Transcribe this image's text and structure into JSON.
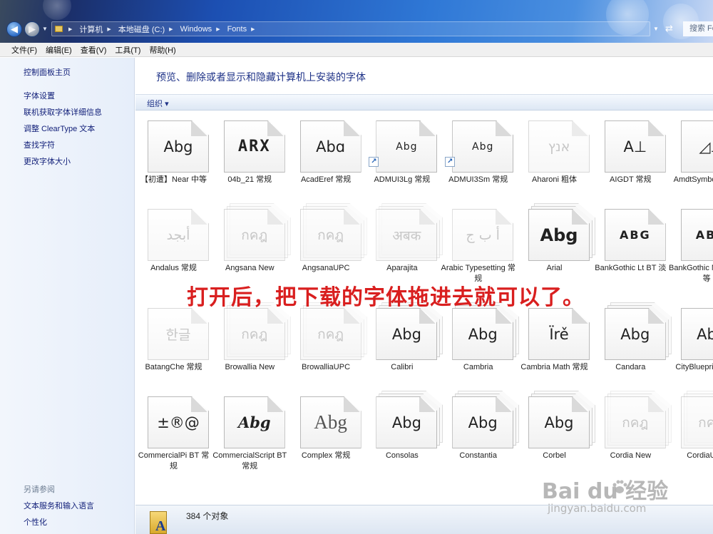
{
  "window": {
    "breadcrumbs": [
      "计算机",
      "本地磁盘 (C:)",
      "Windows",
      "Fonts"
    ],
    "search_placeholder": "搜索 Fo",
    "accent": "#1c4fb2"
  },
  "menu": [
    "文件(F)",
    "编辑(E)",
    "查看(V)",
    "工具(T)",
    "帮助(H)"
  ],
  "sidebar": {
    "home": "控制面板主页",
    "links": [
      "字体设置",
      "联机获取字体详细信息",
      "调整 ClearType 文本",
      "查找字符",
      "更改字体大小"
    ],
    "see_also_heading": "另请参阅",
    "see_also": [
      "文本服务和输入语言",
      "个性化"
    ]
  },
  "main": {
    "heading": "预览、删除或者显示和隐藏计算机上安装的字体",
    "organize": "组织"
  },
  "fonts": [
    {
      "name": "【初遭】Near 中等",
      "sample": "Abg",
      "style": "",
      "stack": false,
      "hidden": false,
      "shortcut": false
    },
    {
      "name": "04b_21 常规",
      "sample": "ARX",
      "style": "mono",
      "stack": false,
      "hidden": false,
      "shortcut": false
    },
    {
      "name": "AcadEref 常规",
      "sample": "Abɑ",
      "style": "",
      "stack": false,
      "hidden": false,
      "shortcut": false
    },
    {
      "name": "ADMUI3Lg 常规",
      "sample": "Abg",
      "style": "small",
      "stack": false,
      "hidden": false,
      "shortcut": true
    },
    {
      "name": "ADMUI3Sm 常规",
      "sample": "Abg",
      "style": "small",
      "stack": false,
      "hidden": false,
      "shortcut": true
    },
    {
      "name": "Aharoni 粗体",
      "sample": "אנץ",
      "style": "ghost",
      "stack": false,
      "hidden": true,
      "shortcut": false
    },
    {
      "name": "AIGDT 常规",
      "sample": "A⊥",
      "style": "",
      "stack": false,
      "hidden": false,
      "shortcut": false
    },
    {
      "name": "AmdtSymbols 常规",
      "sample": "◿⊥",
      "style": "",
      "stack": false,
      "hidden": false,
      "shortcut": false
    },
    {
      "name": "Andalus 常规",
      "sample": "أبجد",
      "style": "ghost",
      "stack": false,
      "hidden": true,
      "shortcut": false
    },
    {
      "name": "Angsana New",
      "sample": "กคฎ",
      "style": "ghost",
      "stack": true,
      "hidden": true,
      "shortcut": false
    },
    {
      "name": "AngsanaUPC",
      "sample": "กคฎ",
      "style": "ghost",
      "stack": true,
      "hidden": true,
      "shortcut": false
    },
    {
      "name": "Aparajita",
      "sample": "अबक",
      "style": "ghost",
      "stack": true,
      "hidden": true,
      "shortcut": false
    },
    {
      "name": "Arabic Typesetting 常规",
      "sample": "أ ب ج",
      "style": "ghost",
      "stack": false,
      "hidden": true,
      "shortcut": false
    },
    {
      "name": "Arial",
      "sample": "Abg",
      "style": "bold",
      "stack": true,
      "hidden": false,
      "shortcut": false
    },
    {
      "name": "BankGothic Lt BT 淡",
      "sample": "ABG",
      "style": "caps",
      "stack": false,
      "hidden": false,
      "shortcut": false
    },
    {
      "name": "BankGothic Md BT 中等",
      "sample": "ABG",
      "style": "caps",
      "stack": false,
      "hidden": false,
      "shortcut": false
    },
    {
      "name": "BatangChe 常规",
      "sample": "한글",
      "style": "ghost",
      "stack": false,
      "hidden": true,
      "shortcut": false
    },
    {
      "name": "Browallia New",
      "sample": "กคฎ",
      "style": "ghost",
      "stack": true,
      "hidden": true,
      "shortcut": false
    },
    {
      "name": "BrowalliaUPC",
      "sample": "กคฎ",
      "style": "ghost",
      "stack": true,
      "hidden": true,
      "shortcut": false
    },
    {
      "name": "Calibri",
      "sample": "Abg",
      "style": "",
      "stack": true,
      "hidden": false,
      "shortcut": false
    },
    {
      "name": "Cambria",
      "sample": "Abg",
      "style": "",
      "stack": true,
      "hidden": false,
      "shortcut": false
    },
    {
      "name": "Cambria Math 常规",
      "sample": "Ïrě",
      "style": "",
      "stack": false,
      "hidden": false,
      "shortcut": false
    },
    {
      "name": "Candara",
      "sample": "Abg",
      "style": "",
      "stack": true,
      "hidden": false,
      "shortcut": false
    },
    {
      "name": "CityBlueprint 常规",
      "sample": "Abg",
      "style": "",
      "stack": false,
      "hidden": false,
      "shortcut": false
    },
    {
      "name": "CommercialPi BT 常规",
      "sample": "±®@",
      "style": "",
      "stack": false,
      "hidden": false,
      "shortcut": false
    },
    {
      "name": "CommercialScript BT 常规",
      "sample": "Abg",
      "style": "serif",
      "stack": false,
      "hidden": false,
      "shortcut": false
    },
    {
      "name": "Complex 常规",
      "sample": "Abg",
      "style": "light",
      "stack": false,
      "hidden": false,
      "shortcut": false
    },
    {
      "name": "Consolas",
      "sample": "Abg",
      "style": "",
      "stack": true,
      "hidden": false,
      "shortcut": false
    },
    {
      "name": "Constantia",
      "sample": "Abg",
      "style": "",
      "stack": true,
      "hidden": false,
      "shortcut": false
    },
    {
      "name": "Corbel",
      "sample": "Abg",
      "style": "",
      "stack": true,
      "hidden": false,
      "shortcut": false
    },
    {
      "name": "Cordia New",
      "sample": "กคฎ",
      "style": "ghost",
      "stack": true,
      "hidden": true,
      "shortcut": false
    },
    {
      "name": "CordiaUPC",
      "sample": "กคฎ",
      "style": "ghost",
      "stack": true,
      "hidden": true,
      "shortcut": false
    }
  ],
  "status": {
    "count": "384 个对象"
  },
  "overlay": {
    "caption": "打开后，把下载的字体拖进去就可以了。",
    "watermark_main": "Bai du 经验",
    "watermark_sub": "jingyan.baidu.com",
    "caption_color": "#d91f1f"
  }
}
